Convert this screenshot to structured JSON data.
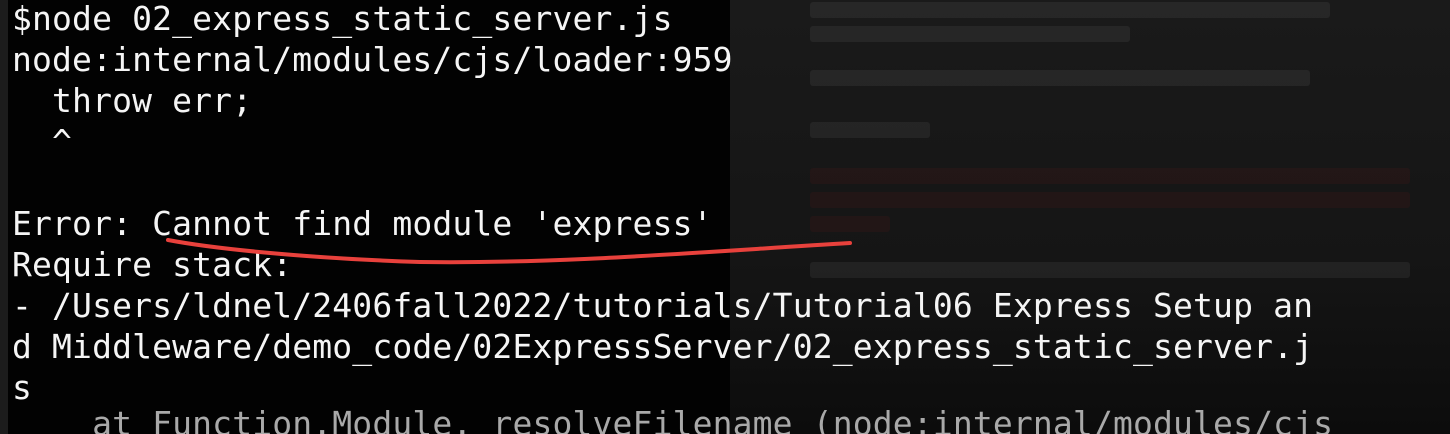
{
  "terminal": {
    "lines": [
      "$node 02_express_static_server.js",
      "node:internal/modules/cjs/loader:959",
      "  throw err;",
      "  ^",
      "",
      "Error: Cannot find module 'express'",
      "Require stack:",
      "- /Users/ldnel/2406fall2022/tutorials/Tutorial06 Express Setup an",
      "d Middleware/demo_code/02ExpressServer/02_express_static_server.j",
      "s",
      "    at Function.Module._resolveFilename (node:internal/modules/cjs"
    ]
  },
  "annotation": {
    "color": "#e8413c",
    "marks": "Cannot find module 'express'"
  }
}
